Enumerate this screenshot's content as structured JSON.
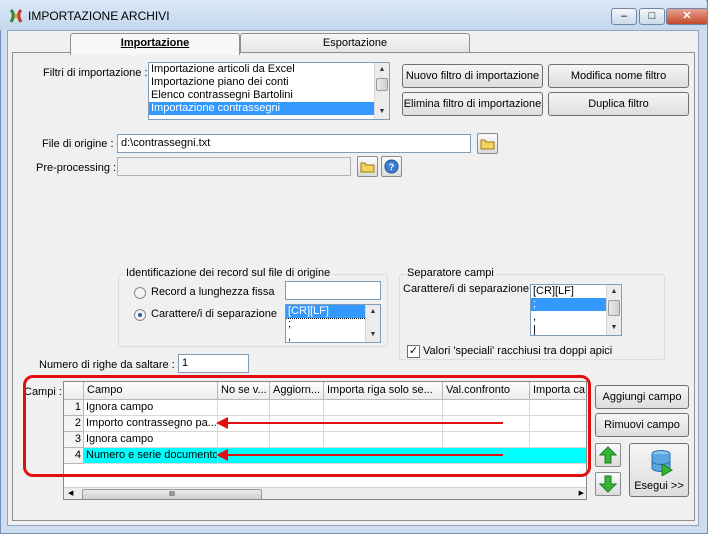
{
  "window": {
    "title": "IMPORTAZIONE ARCHIVI",
    "controls": [
      "minimize",
      "maximize",
      "close"
    ]
  },
  "tabs": [
    {
      "label": "Importazione",
      "active": true
    },
    {
      "label": "Esportazione",
      "active": false
    }
  ],
  "filters": {
    "label": "Filtri di importazione :",
    "items": [
      "Importazione articoli da Excel",
      "Importazione piano dei conti",
      "Elenco contrassegni Bartolini",
      "Importazione contrassegni"
    ],
    "selected_index": 3,
    "buttons": {
      "new": "Nuovo filtro di importazione",
      "rename": "Modifica nome filtro",
      "delete": "Elimina filtro di importazione",
      "duplicate": "Duplica filtro"
    }
  },
  "source_file": {
    "label": "File di origine :",
    "value": "d:\\contrassegni.txt"
  },
  "preprocessing": {
    "label": "Pre-processing :",
    "value": ""
  },
  "record_id": {
    "title": "Identificazione dei record sul file di origine",
    "fixed_label": "Record a lunghezza fissa",
    "separator_label": "Carattere/i di separazione",
    "selected": "separator",
    "separator_items": [
      "[CR][LF]",
      ";",
      ","
    ]
  },
  "field_separator": {
    "title": "Separatore campi",
    "label": "Carattere/i di separazione",
    "items": [
      "[CR][LF]",
      ";",
      ",",
      "|"
    ],
    "selected_index": 1,
    "quoted_label": "Valori 'speciali' racchiusi tra doppi apici",
    "quoted_checked": true
  },
  "skip_rows": {
    "label": "Numero di righe da saltare :",
    "value": "1"
  },
  "fields": {
    "label": "Campi :",
    "columns": [
      "Campo",
      "No se v...",
      "Aggiorn...",
      "Importa riga solo se...",
      "Val.confronto",
      "Importa ca"
    ],
    "rows": [
      {
        "num": "1",
        "campo": "Ignora campo"
      },
      {
        "num": "2",
        "campo": "Importo contrassegno pa..."
      },
      {
        "num": "3",
        "campo": "Ignora campo"
      },
      {
        "num": "4",
        "campo": "Numero e serie documento"
      }
    ],
    "selected_row": 4,
    "highlight_color": "#00ffff",
    "scroll_grip": "III"
  },
  "side_buttons": {
    "add": "Aggiungi campo",
    "remove": "Rimuovi campo",
    "run": "Esegui >>"
  },
  "colors": {
    "accent_selection": "#3399ff",
    "annotation_red": "#e01010"
  }
}
